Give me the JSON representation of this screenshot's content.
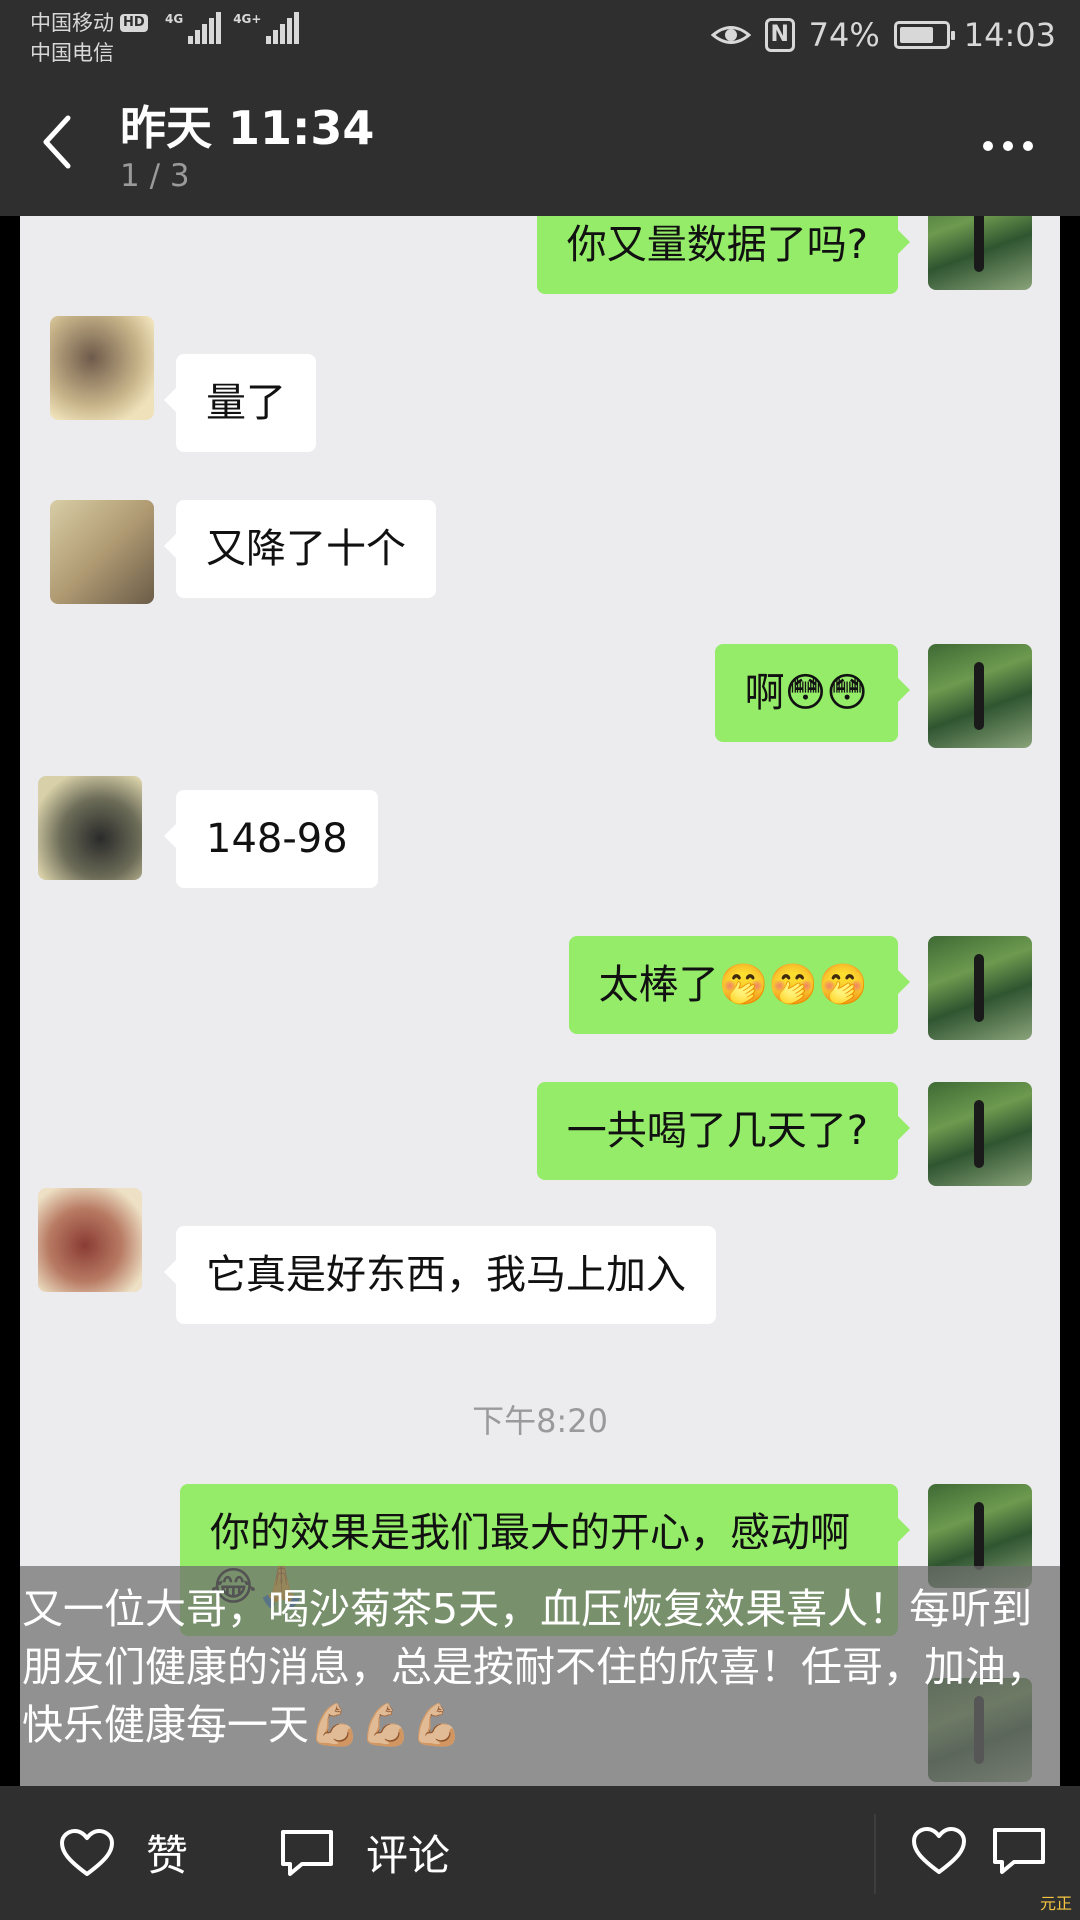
{
  "status_bar": {
    "carrier_1": "中国移动",
    "hd_badge": "HD",
    "carrier_2": "中国电信",
    "network_1": "4G",
    "network_2": "4G+",
    "battery_percent_text": "74%",
    "battery_level": 0.74,
    "time": "14:03"
  },
  "header": {
    "title": "昨天 11:34",
    "page_indicator": "1 / 3"
  },
  "chat": {
    "messages": [
      {
        "side": "right",
        "text": "你又量数据了吗?"
      },
      {
        "side": "left",
        "text": "量了"
      },
      {
        "side": "left",
        "text": "又降了十个"
      },
      {
        "side": "right",
        "text": "啊😳😳"
      },
      {
        "side": "left",
        "text": "148-98"
      },
      {
        "side": "right",
        "text": "太棒了🤭🤭🤭"
      },
      {
        "side": "right",
        "text": "一共喝了几天了?"
      },
      {
        "side": "left",
        "text": "它真是好东西，我马上加入"
      },
      {
        "side": "right",
        "text": "你的效果是我们最大的开心，感动啊😂🙏"
      }
    ],
    "timestamp": "下午8:20"
  },
  "caption": {
    "text": "又一位大哥，喝沙菊茶5天，血压恢复效果喜人！每听到朋友们健康的消息，总是按耐不住的欣喜！任哥，加油，快乐健康每一天💪🏼💪🏼💪🏼"
  },
  "bottom_bar": {
    "like_label": "赞",
    "comment_label": "评论",
    "watermark": "元正"
  },
  "colors": {
    "bar_bg": "#2f2f2f",
    "chat_bg": "#ececef",
    "bubble_green": "#95ec69",
    "bubble_white": "#ffffff"
  }
}
